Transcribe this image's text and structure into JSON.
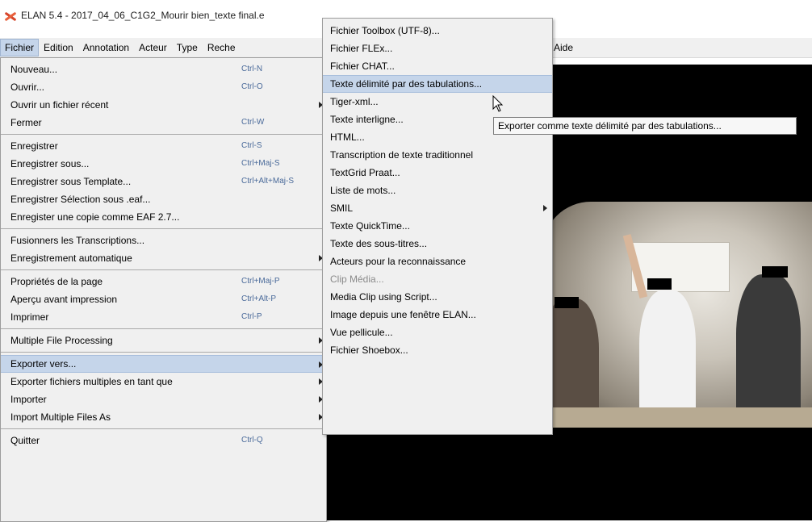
{
  "window": {
    "title": "ELAN 5.4 - 2017_04_06_C1G2_Mourir bien_texte final.e",
    "icon": "elan-logo-icon"
  },
  "menubar": {
    "items": [
      "Fichier",
      "Edition",
      "Annotation",
      "Acteur",
      "Type",
      "Reche"
    ],
    "help_label": "Aide"
  },
  "fichier_menu": {
    "nouveau": {
      "label": "Nouveau...",
      "shortcut": "Ctrl-N"
    },
    "ouvrir": {
      "label": "Ouvrir...",
      "shortcut": "Ctrl-O"
    },
    "ouvrir_recent": {
      "label": "Ouvrir un fichier récent"
    },
    "fermer": {
      "label": "Fermer",
      "shortcut": "Ctrl-W"
    },
    "enregistrer": {
      "label": "Enregistrer",
      "shortcut": "Ctrl-S"
    },
    "enregistrer_sous": {
      "label": "Enregistrer sous...",
      "shortcut": "Ctrl+Maj-S"
    },
    "enregistrer_template": {
      "label": "Enregistrer sous Template...",
      "shortcut": "Ctrl+Alt+Maj-S"
    },
    "enregistrer_selection": {
      "label": "Enregistrer Sélection sous .eaf..."
    },
    "enregistrer_copie": {
      "label": "Enregister une copie comme EAF 2.7..."
    },
    "fusionner": {
      "label": "Fusionners les Transcriptions..."
    },
    "enregistrement_auto": {
      "label": "Enregistrement automatique"
    },
    "proprietes_page": {
      "label": "Propriétés de la page",
      "shortcut": "Ctrl+Maj-P"
    },
    "apercu": {
      "label": "Aperçu avant impression",
      "shortcut": "Ctrl+Alt-P"
    },
    "imprimer": {
      "label": "Imprimer",
      "shortcut": "Ctrl-P"
    },
    "multiple_processing": {
      "label": "Multiple File Processing"
    },
    "exporter_vers": {
      "label": "Exporter vers..."
    },
    "exporter_multiples": {
      "label": "Exporter fichiers multiples en tant que"
    },
    "importer": {
      "label": "Importer"
    },
    "import_multiple": {
      "label": "Import Multiple Files As"
    },
    "quitter": {
      "label": "Quitter",
      "shortcut": "Ctrl-Q"
    }
  },
  "export_submenu": {
    "items": [
      "Fichier Toolbox (UTF-8)...",
      "Fichier FLEx...",
      "Fichier CHAT...",
      "Texte délimité par des tabulations...",
      "Tiger-xml...",
      "Texte interligne...",
      "HTML...",
      "Transcription de texte traditionnel",
      "TextGrid Praat...",
      "Liste de mots...",
      "SMIL",
      "Texte QuickTime...",
      "Texte des sous-titres...",
      "Acteurs pour la reconnaissance",
      "Clip Média...",
      "Media Clip using Script...",
      "Image depuis une fenêtre ELAN...",
      "Vue pellicule...",
      "Fichier Shoebox..."
    ]
  },
  "tooltip": {
    "text": "Exporter comme texte délimité par des tabulations..."
  },
  "colors": {
    "menu_bg": "#f0f0f0",
    "highlight": "#c5d5ea",
    "shortcut": "#4a6a9a",
    "video_bg": "#000000"
  }
}
